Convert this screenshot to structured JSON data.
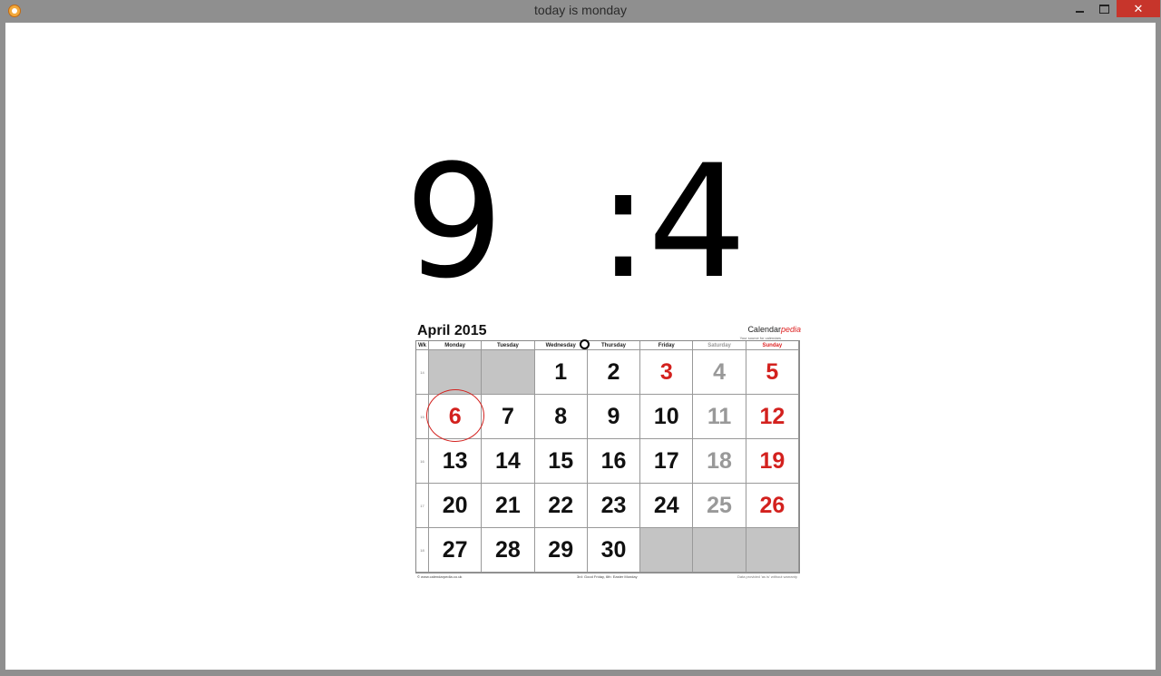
{
  "window": {
    "title": "today is monday",
    "controls": {
      "minimize": "",
      "maximize": "",
      "close": "✕"
    }
  },
  "clock": {
    "hour": "9",
    "colon": ":",
    "minute": "4"
  },
  "calendar": {
    "title": "April 2015",
    "brand": {
      "main": "Calendar",
      "accent": "pedia",
      "tagline": "Your source for calendars"
    },
    "week_header": "Wk",
    "days": [
      "Monday",
      "Tuesday",
      "Wednesday",
      "Thursday",
      "Friday",
      "Saturday",
      "Sunday"
    ],
    "weeks": [
      {
        "wk": "14",
        "cells": [
          "",
          "",
          "1",
          "2",
          "3",
          "4",
          "5"
        ]
      },
      {
        "wk": "15",
        "cells": [
          "6",
          "7",
          "8",
          "9",
          "10",
          "11",
          "12"
        ]
      },
      {
        "wk": "16",
        "cells": [
          "13",
          "14",
          "15",
          "16",
          "17",
          "18",
          "19"
        ]
      },
      {
        "wk": "17",
        "cells": [
          "20",
          "21",
          "22",
          "23",
          "24",
          "25",
          "26"
        ]
      },
      {
        "wk": "18",
        "cells": [
          "27",
          "28",
          "29",
          "30",
          "",
          "",
          ""
        ]
      }
    ],
    "highlighted_day": "6",
    "colors": {
      "holiday": "#d3211e",
      "weekend_saturday": "#999999",
      "empty": "#c4c4c4"
    },
    "footer": {
      "left": "© www.calendarpedia.co.uk",
      "center": "3rd: Good Friday, 6th: Easter Monday",
      "right": "Data provided 'as is' without warranty"
    }
  }
}
